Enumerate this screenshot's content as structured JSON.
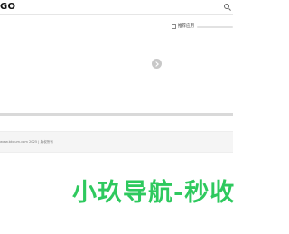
{
  "header": {
    "logo_text": "GO",
    "search_icon": "search-icon"
  },
  "sidebar": {
    "recommend_label": "推荐应用",
    "recommend_icon": "grid-icon"
  },
  "carousel": {
    "next_icon": "chevron-right-icon"
  },
  "footer": {
    "copyright": "www.bkqum.com 2025 | 版权所有"
  },
  "watermark": {
    "text": "小玖导航-秒收"
  },
  "colors": {
    "watermark": "#2ec95e",
    "footer_bg": "#f5f5f5",
    "divider": "#d9d9d9"
  }
}
